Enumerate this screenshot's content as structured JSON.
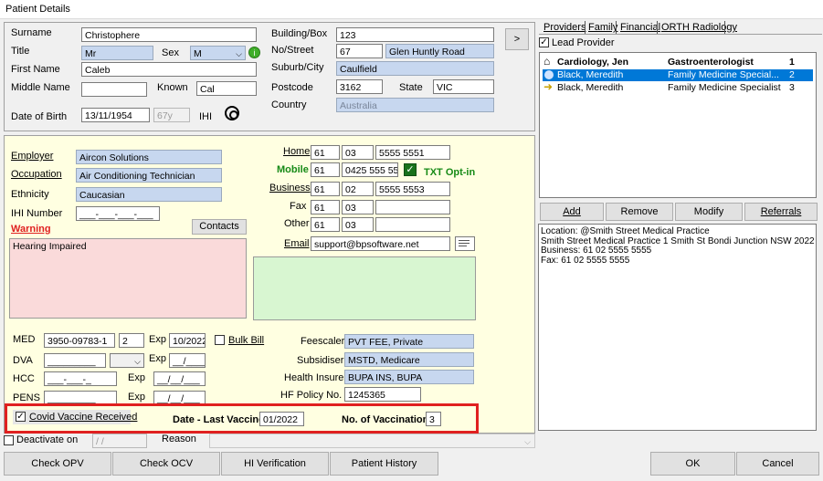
{
  "window": {
    "title": "Patient Details"
  },
  "details": {
    "surname_label": "Surname",
    "surname": "Christophere",
    "title_label": "Title",
    "title": "Mr",
    "sex_label": "Sex",
    "sex": "M",
    "first_name_label": "First Name",
    "first_name": "Caleb",
    "middle_name_label": "Middle Name",
    "middle_name": "",
    "known_label": "Known",
    "known": "Cal",
    "dob_label": "Date of Birth",
    "dob": "13/11/1954",
    "age": "67y",
    "ihi_label": "IHI",
    "building_label": "Building/Box",
    "building": "123",
    "no_street_label": "No/Street",
    "street_no": "67",
    "street_name": "Glen Huntly Road",
    "suburb_label": "Suburb/City",
    "suburb": "Caulfield",
    "postcode_label": "Postcode",
    "postcode": "3162",
    "state_label": "State",
    "state": "VIC",
    "country_label": "Country",
    "country": "Australia",
    "next_label": ">"
  },
  "work": {
    "employer_label": "Employer",
    "employer": "Aircon Solutions",
    "occupation_label": "Occupation",
    "occupation": "Air Conditioning Technician",
    "ethnicity_label": "Ethnicity",
    "ethnicity": "Caucasian",
    "ihi_number_label": "IHI Number",
    "ihi_number": "___-___-___-___",
    "warning_label": "Warning",
    "contacts_label": "Contacts",
    "warning_text": "Hearing Impaired"
  },
  "phones": {
    "home_label": "Home",
    "home": [
      "61",
      "03",
      "5555 5551"
    ],
    "mobile_label": "Mobile",
    "mobile": [
      "61",
      "0425 555 552"
    ],
    "txt_optin": "TXT Opt-in",
    "business_label": "Business",
    "business": [
      "61",
      "02",
      "5555 5553"
    ],
    "fax_label": "Fax",
    "fax": [
      "61",
      "03",
      ""
    ],
    "other_label": "Other",
    "other": [
      "61",
      "03",
      ""
    ],
    "email_label": "Email",
    "email": "support@bpsoftware.net"
  },
  "billing": {
    "med_label": "MED",
    "med": "3950-09783-1",
    "med_irn": "2",
    "exp_label": "Exp",
    "med_exp": "10/2022",
    "bulk_bill_label": "Bulk Bill",
    "dva_label": "DVA",
    "dva": "_________",
    "dva_exp": "__/____",
    "hcc_label": "HCC",
    "hcc": "___-___-_",
    "hcc_exp": "__/__/___",
    "pens_label": "PENS",
    "pens": "_________",
    "pens_exp": "__/__/___",
    "feescaler_label": "Feescaler",
    "feescaler": "PVT FEE, Private",
    "subsidiser_label": "Subsidiser",
    "subsidiser": "MSTD, Medicare",
    "health_insurer_label": "Health Insurer",
    "health_insurer": "BUPA INS, BUPA",
    "hf_policy_label": "HF Policy No.",
    "hf_policy": "1245365"
  },
  "covid": {
    "received_label": "Covid Vaccine Received",
    "last_vaccine_label": "Date - Last Vaccine",
    "last_vaccine": "01/2022",
    "count_label": "No. of Vaccinations",
    "count": "3"
  },
  "deactivate": {
    "label": "Deactivate on",
    "date": " / /",
    "reason_label": "Reason"
  },
  "providers": {
    "tabs": [
      "Providers",
      "Family",
      "Financial",
      "ORTH Radiology"
    ],
    "lead_provider_label": "Lead Provider",
    "rows": [
      {
        "name": "Cardiology, Jen",
        "specialty": "Gastroenterologist",
        "num": "1"
      },
      {
        "name": "Black, Meredith",
        "specialty": "Family Medicine Special...",
        "num": "2"
      },
      {
        "name": "Black, Meredith",
        "specialty": "Family Medicine Specialist",
        "num": "3"
      }
    ],
    "add_label": "Add",
    "remove_label": "Remove",
    "modify_label": "Modify",
    "referrals_label": "Referrals",
    "location_lines": [
      "Location: @Smith Street Medical Practice",
      "Smith Street Medical Practice 1 Smith St Bondi Junction NSW 2022",
      "Business: 61 02 5555 5555",
      "Fax: 61 02 5555 5555"
    ]
  },
  "footer": {
    "check_opv": "Check OPV",
    "check_ocv": "Check OCV",
    "hi_verification": "HI Verification",
    "patient_history": "Patient History",
    "ok": "OK",
    "cancel": "Cancel"
  },
  "colors": {
    "readonly_field": "#c7d7ef",
    "warning_box": "#fadada",
    "notes_box": "#d8f6d1",
    "panel_bg": "#ffffe1",
    "highlight": "#e02020",
    "selection": "#0078d7"
  }
}
